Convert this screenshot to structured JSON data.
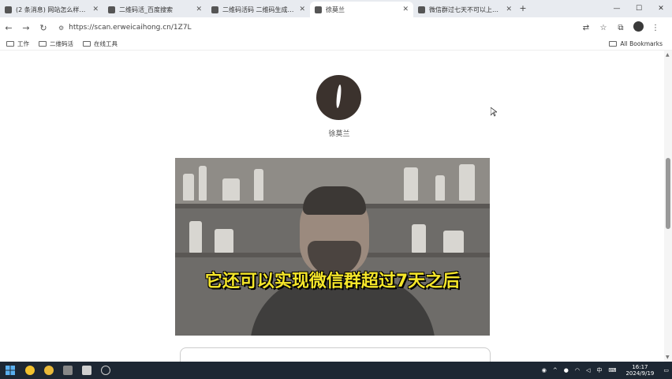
{
  "browser": {
    "tabs": [
      {
        "title": "(2 条消息) 网站怎么样被引用...",
        "active": false
      },
      {
        "title": "二维码活_百度搜索",
        "active": false
      },
      {
        "title": "二维码活码 二维码生成器(平台)",
        "active": false
      },
      {
        "title": "徐莫兰",
        "active": true
      },
      {
        "title": "微信群过七天不可以上码的原因",
        "active": false
      }
    ],
    "new_tab_label": "+",
    "address": "https://scan.erweicaihong.cn/1Z7L",
    "bookmarks": [
      "工作",
      "二维码活",
      "在线工具"
    ],
    "all_bookmarks_label": "All Bookmarks"
  },
  "page": {
    "profile_name": "徐莫兰",
    "video_subtitle": "它还可以实现微信群超过7天之后"
  },
  "taskbar": {
    "tray_ime": "中",
    "time": "16:17",
    "date": "2024/9/19"
  },
  "colors": {
    "subtitle": "#f5e62a",
    "taskbar": "#1d2733",
    "avatar": "#3b322d"
  }
}
